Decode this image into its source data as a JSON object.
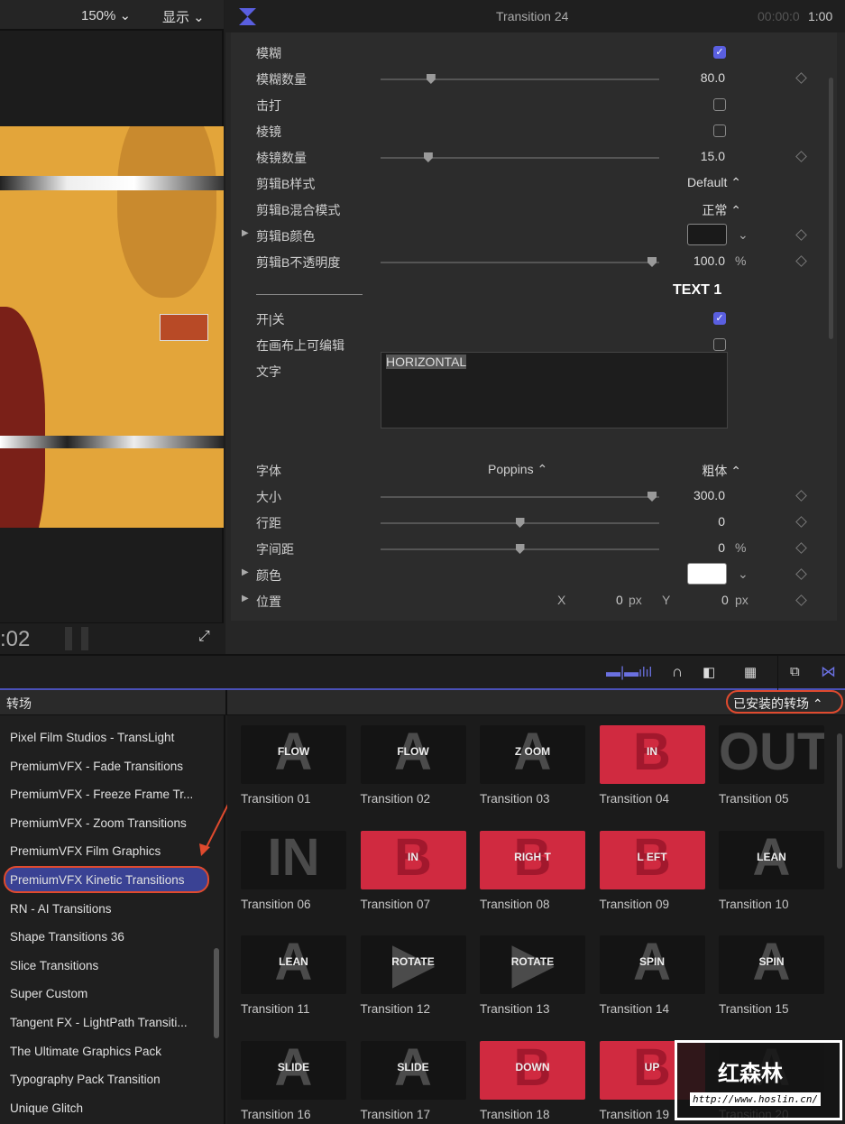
{
  "viewer": {
    "zoom": "150%",
    "display": "显示",
    "timecode": ":02"
  },
  "inspector": {
    "title": "Transition 24",
    "timecode_dim": "00:00:0",
    "timecode": "1:00",
    "rows": [
      {
        "label": "模糊",
        "type": "check",
        "checked": true
      },
      {
        "label": "模糊数量",
        "type": "slider",
        "pos": 0.17,
        "value": "80.0"
      },
      {
        "label": "击打",
        "type": "check",
        "checked": false
      },
      {
        "label": "棱镜",
        "type": "check",
        "checked": false
      },
      {
        "label": "棱镜数量",
        "type": "slider",
        "pos": 0.16,
        "value": "15.0"
      },
      {
        "label": "剪辑B样式",
        "type": "popup",
        "value": "Default"
      },
      {
        "label": "剪辑B混合模式",
        "type": "popup",
        "value": "正常"
      },
      {
        "label": "剪辑B颜色",
        "type": "color",
        "color": "#1a1a1a",
        "expand": true
      },
      {
        "label": "剪辑B不透明度",
        "type": "slider",
        "pos": 0.99,
        "value": "100.0",
        "unit": "%"
      }
    ],
    "section": "TEXT 1",
    "rows2": [
      {
        "label": "开|关",
        "type": "check",
        "checked": true
      },
      {
        "label": "在画布上可编辑",
        "type": "check",
        "checked": false
      },
      {
        "label": "文字",
        "type": "text",
        "value": "HORIZONTAL"
      }
    ],
    "rows3": [
      {
        "label": "字体",
        "type": "font",
        "font": "Poppins",
        "weight": "粗体"
      },
      {
        "label": "大小",
        "type": "slider",
        "pos": 0.99,
        "value": "300.0"
      },
      {
        "label": "行距",
        "type": "slider",
        "pos": 0.5,
        "value": "0"
      },
      {
        "label": "字间距",
        "type": "slider",
        "pos": 0.5,
        "value": "0",
        "unit": "%"
      },
      {
        "label": "颜色",
        "type": "color",
        "color": "#ffffff",
        "expand": true
      },
      {
        "label": "位置",
        "type": "xy",
        "x": "0",
        "y": "0",
        "unit": "px",
        "expand": true
      }
    ]
  },
  "browser": {
    "title": "转场",
    "filter": "已安装的转场",
    "accent": "#e04a2e",
    "sidebar": [
      "Pixel Film Studios - TransLight",
      "PremiumVFX - Fade Transitions",
      "PremiumVFX - Freeze Frame Tr...",
      "PremiumVFX - Zoom Transitions",
      "PremiumVFX Film Graphics",
      "PremiumVFX Kinetic Transitions",
      "RN - AI Transitions",
      "Shape Transitions 36",
      "Slice Transitions",
      "Super Custom",
      "Tangent FX - LightPath Transiti...",
      "The Ultimate Graphics Pack",
      "Typography Pack Transition",
      "Unique Glitch"
    ],
    "selected": 5,
    "items": [
      {
        "name": "Transition 01",
        "text": "FLOW",
        "big": "A",
        "red": false
      },
      {
        "name": "Transition 02",
        "text": "FLOW",
        "big": "A",
        "red": false
      },
      {
        "name": "Transition 03",
        "text": "Z OOM",
        "big": "A",
        "red": false
      },
      {
        "name": "Transition 04",
        "text": "IN",
        "big": "B",
        "red": true
      },
      {
        "name": "Transition 05",
        "text": "",
        "big": "OUT",
        "red": false
      },
      {
        "name": "Transition 06",
        "text": "",
        "big": "IN",
        "red": false
      },
      {
        "name": "Transition 07",
        "text": "IN",
        "big": "B",
        "red": true
      },
      {
        "name": "Transition 08",
        "text": "RIGH T",
        "big": "B",
        "red": true
      },
      {
        "name": "Transition 09",
        "text": "L EFT",
        "big": "B",
        "red": true
      },
      {
        "name": "Transition 10",
        "text": "LEAN",
        "big": "A",
        "red": false
      },
      {
        "name": "Transition 11",
        "text": "LEAN",
        "big": "A",
        "red": false
      },
      {
        "name": "Transition 12",
        "text": "ROTATE",
        "big": "▶",
        "red": false
      },
      {
        "name": "Transition 13",
        "text": "ROTATE",
        "big": "▶",
        "red": false
      },
      {
        "name": "Transition 14",
        "text": "SPIN",
        "big": "A",
        "red": false
      },
      {
        "name": "Transition 15",
        "text": "SPIN",
        "big": "A",
        "red": false
      },
      {
        "name": "Transition 16",
        "text": "SLIDE",
        "big": "A",
        "red": false
      },
      {
        "name": "Transition 17",
        "text": "SLIDE",
        "big": "A",
        "red": false
      },
      {
        "name": "Transition 18",
        "text": "DOWN",
        "big": "B",
        "red": true
      },
      {
        "name": "Transition 19",
        "text": "UP",
        "big": "B",
        "red": true
      },
      {
        "name": "Transition 20",
        "text": "",
        "big": "A",
        "red": false
      }
    ]
  },
  "watermark": {
    "title": "红森林",
    "url": "http://www.hoslin.cn/"
  }
}
